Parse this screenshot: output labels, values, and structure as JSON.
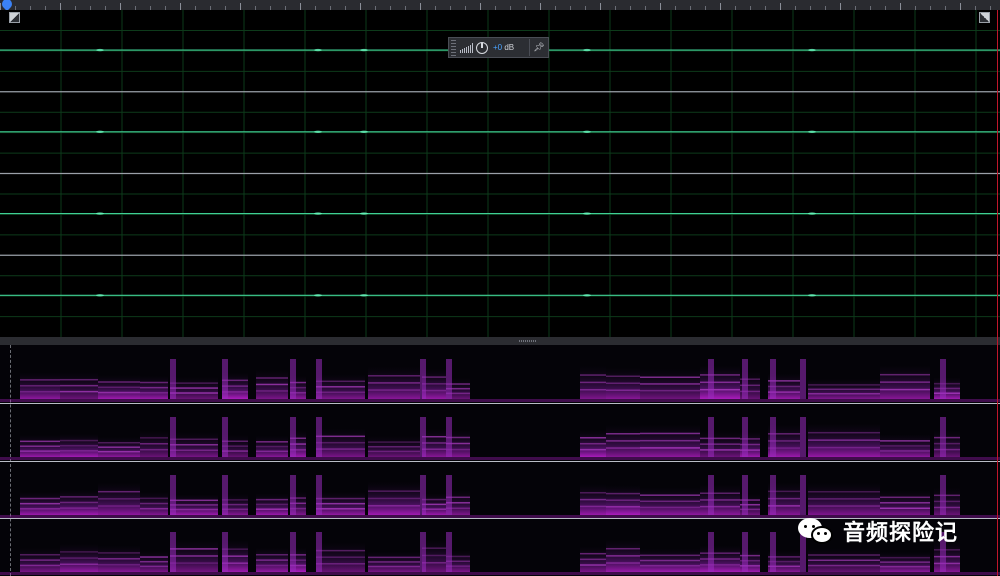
{
  "hud": {
    "gain_value": "+0",
    "gain_unit": "dB",
    "level_icon": "level-meter-icon",
    "knob_icon": "volume-knob-icon",
    "pin_icon": "pin-icon"
  },
  "watermark": {
    "text": "音频探险记",
    "icon": "wechat-icon"
  },
  "colors": {
    "waveform_line": "#3fcf95",
    "waveform_grid": "#0d3a1a",
    "spectral_accent": "#b020c8",
    "channel_separator": "#b9bcc5",
    "playhead": "#3b82f6"
  },
  "channel_count": 4
}
